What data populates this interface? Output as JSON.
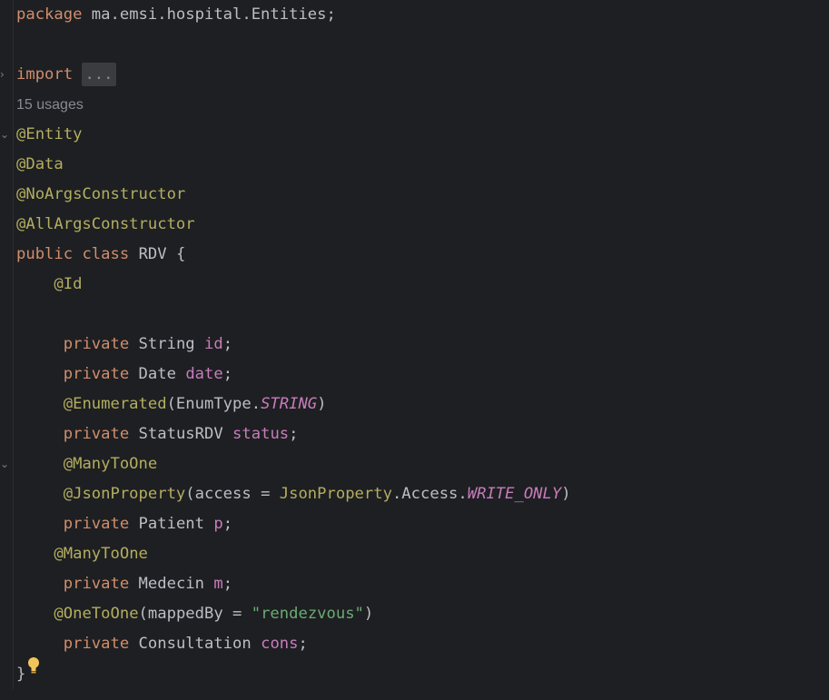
{
  "editor": {
    "lines": {
      "package": {
        "keyword": "package",
        "name": "ma.emsi.hospital.Entities",
        "semicolon": ";"
      },
      "import": {
        "keyword": "import",
        "folded": "..."
      },
      "usages": "15 usages",
      "ann_entity": "@Entity",
      "ann_data": "@Data",
      "ann_noargs": "@NoArgsConstructor",
      "ann_allargs": "@AllArgsConstructor",
      "class_decl": {
        "public": "public",
        "class": "class",
        "name": "RDV {"
      },
      "ann_id": "@Id",
      "field_id": {
        "modifier": "private",
        "type": "String",
        "name": "id",
        "end": ";"
      },
      "field_date": {
        "modifier": "private",
        "type": "Date",
        "name": "date",
        "end": ";"
      },
      "ann_enumerated": {
        "annotation": "@Enumerated",
        "open": "(EnumType.",
        "const": "STRING",
        "close": ")"
      },
      "field_status": {
        "modifier": "private",
        "type": "StatusRDV",
        "name": "status",
        "end": ";"
      },
      "ann_manytoone_1": "@ManyToOne",
      "ann_json": {
        "annotation": "@JsonProperty",
        "open": "(access = ",
        "cls": "JsonProperty",
        "mid": ".Access.",
        "const": "WRITE_ONLY",
        "close": ")"
      },
      "field_patient": {
        "modifier": "private",
        "type": "Patient",
        "name": "p",
        "end": ";"
      },
      "ann_manytoone_2": "@ManyToOne",
      "field_medecin": {
        "modifier": "private",
        "type": "Medecin",
        "name": "m",
        "end": ";"
      },
      "ann_onetoone": {
        "annotation": "@OneToOne",
        "open": "(mappedBy = ",
        "string": "\"rendezvous\"",
        "close": ")"
      },
      "field_cons": {
        "modifier": "private",
        "type": "Consultation",
        "name": "cons",
        "end": ";"
      },
      "close_brace": "}"
    },
    "icons": {
      "fold_collapsed": "chevron-right-icon",
      "fold_expanded": "chevron-down-icon",
      "intention": "lightbulb-icon"
    },
    "colors": {
      "background": "#1e1f22",
      "keyword": "#cf8e6d",
      "annotation": "#b3ae60",
      "field": "#c77dbb",
      "string": "#6aab73",
      "text": "#bcbec4"
    }
  }
}
